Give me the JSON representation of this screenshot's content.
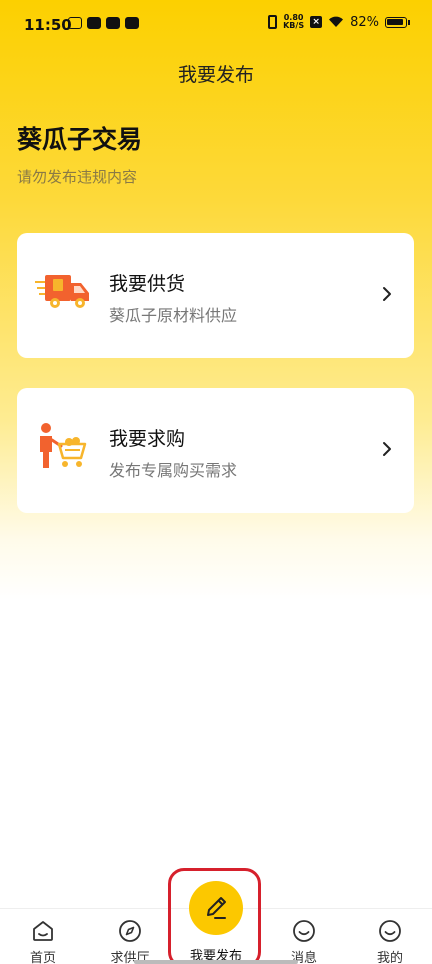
{
  "status_bar": {
    "time": "11:50",
    "speed_value": "0.80",
    "speed_unit": "KB/S",
    "battery": "82%"
  },
  "header": {
    "title": "我要发布"
  },
  "hero": {
    "heading": "葵瓜子交易",
    "subheading": "请勿发布违规内容"
  },
  "cards": [
    {
      "title": "我要供货",
      "desc": "葵瓜子原材料供应",
      "icon": "delivery-truck-icon"
    },
    {
      "title": "我要求购",
      "desc": "发布专属购买需求",
      "icon": "shopping-cart-person-icon"
    }
  ],
  "bottom_nav": {
    "items": [
      {
        "label": "首页",
        "icon": "home-icon"
      },
      {
        "label": "求供厅",
        "icon": "compass-icon"
      },
      {
        "label": "我要发布",
        "icon": "pencil-icon"
      },
      {
        "label": "消息",
        "icon": "smiley-icon"
      },
      {
        "label": "我的",
        "icon": "profile-smiley-icon"
      }
    ]
  },
  "colors": {
    "accent_yellow": "#FCC800",
    "highlight_red": "#D6202C",
    "truck_orange": "#F2622E",
    "truck_yellow": "#F7B52C"
  }
}
